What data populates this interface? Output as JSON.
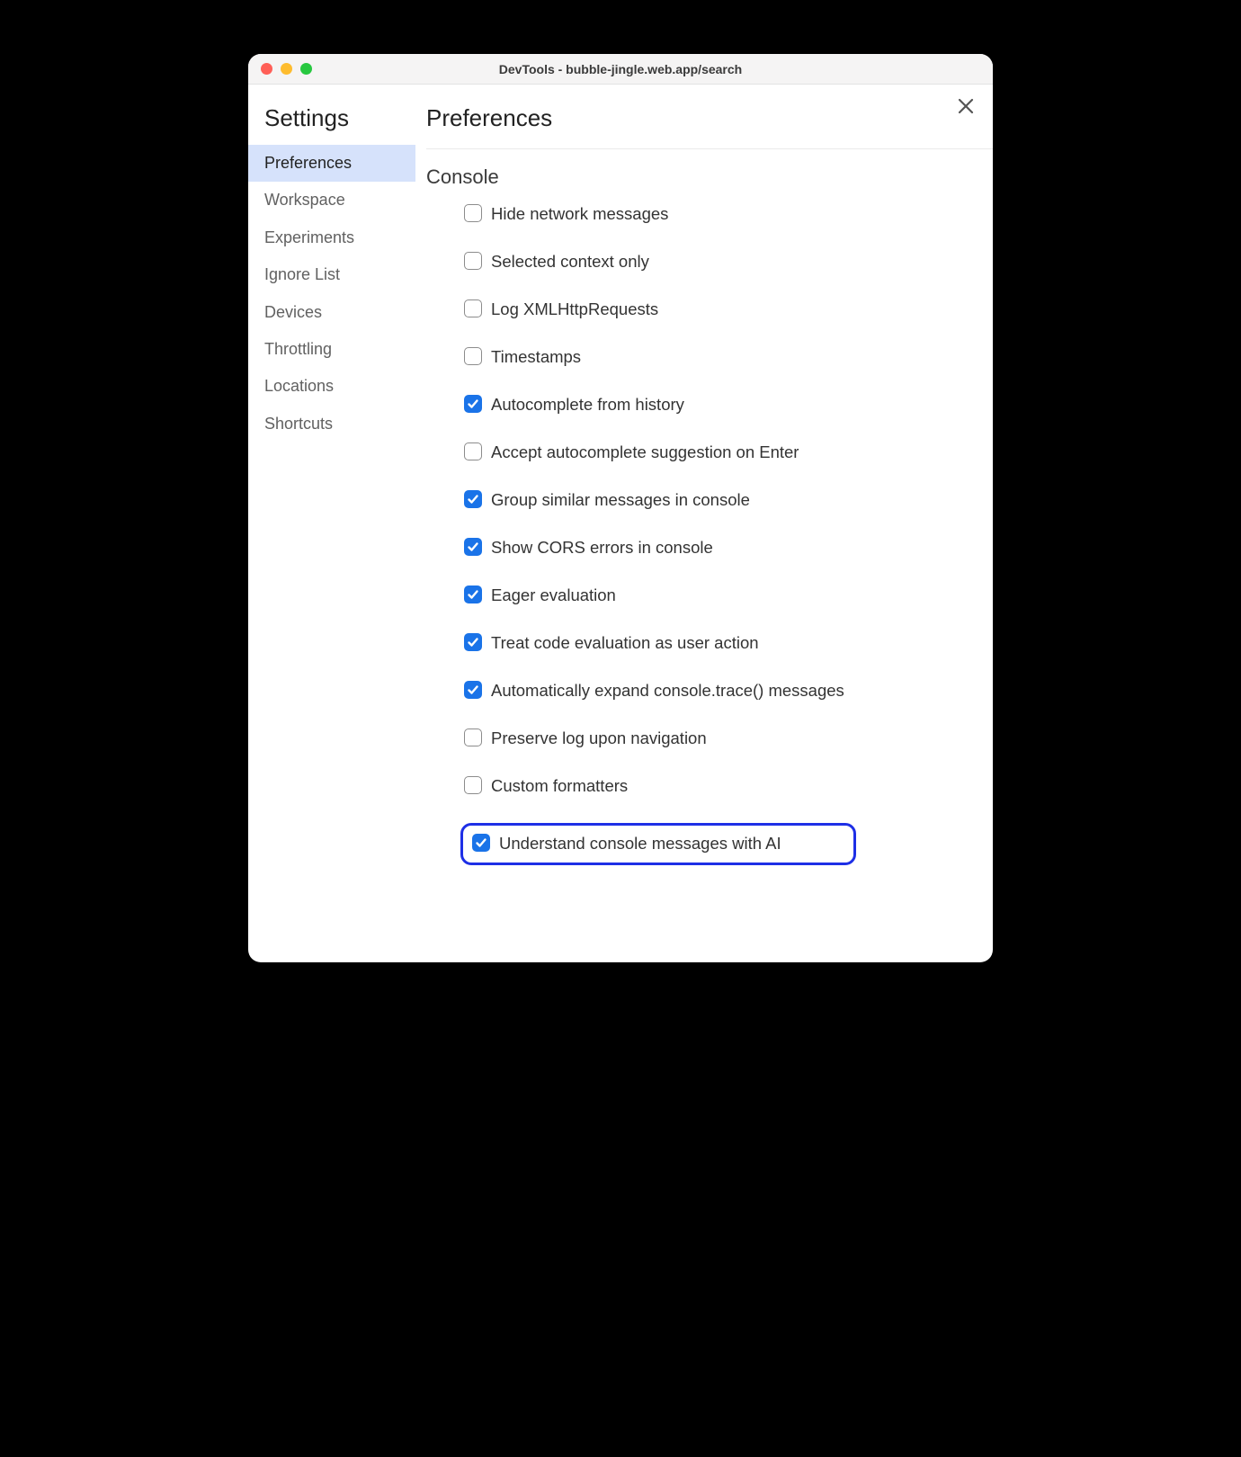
{
  "titlebar": {
    "title": "DevTools - bubble-jingle.web.app/search"
  },
  "sidebar": {
    "title": "Settings",
    "items": [
      {
        "label": "Preferences",
        "active": true
      },
      {
        "label": "Workspace",
        "active": false
      },
      {
        "label": "Experiments",
        "active": false
      },
      {
        "label": "Ignore List",
        "active": false
      },
      {
        "label": "Devices",
        "active": false
      },
      {
        "label": "Throttling",
        "active": false
      },
      {
        "label": "Locations",
        "active": false
      },
      {
        "label": "Shortcuts",
        "active": false
      }
    ]
  },
  "main": {
    "title": "Preferences",
    "section": {
      "title": "Console",
      "options": [
        {
          "label": "Hide network messages",
          "checked": false,
          "highlight": false
        },
        {
          "label": "Selected context only",
          "checked": false,
          "highlight": false
        },
        {
          "label": "Log XMLHttpRequests",
          "checked": false,
          "highlight": false
        },
        {
          "label": "Timestamps",
          "checked": false,
          "highlight": false
        },
        {
          "label": "Autocomplete from history",
          "checked": true,
          "highlight": false
        },
        {
          "label": "Accept autocomplete suggestion on Enter",
          "checked": false,
          "highlight": false
        },
        {
          "label": "Group similar messages in console",
          "checked": true,
          "highlight": false
        },
        {
          "label": "Show CORS errors in console",
          "checked": true,
          "highlight": false
        },
        {
          "label": "Eager evaluation",
          "checked": true,
          "highlight": false
        },
        {
          "label": "Treat code evaluation as user action",
          "checked": true,
          "highlight": false
        },
        {
          "label": "Automatically expand console.trace() messages",
          "checked": true,
          "highlight": false
        },
        {
          "label": "Preserve log upon navigation",
          "checked": false,
          "highlight": false
        },
        {
          "label": "Custom formatters",
          "checked": false,
          "highlight": false
        },
        {
          "label": "Understand console messages with AI",
          "checked": true,
          "highlight": true
        }
      ]
    }
  }
}
